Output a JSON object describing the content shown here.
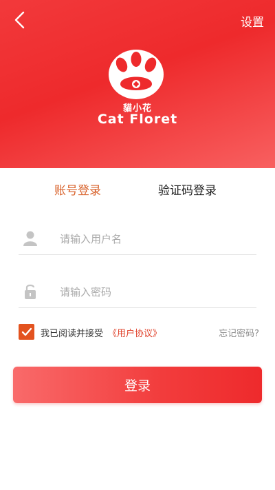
{
  "header": {
    "settings_label": "设置",
    "brand_cn": "貓小花",
    "brand_en": "Cat Floret"
  },
  "tabs": [
    {
      "label": "账号登录",
      "active": true
    },
    {
      "label": "验证码登录",
      "active": false
    }
  ],
  "form": {
    "username_placeholder": "请输入用户名",
    "password_placeholder": "请输入密码",
    "username_value": "",
    "password_value": ""
  },
  "agreement": {
    "checked": true,
    "text": "我已阅读并接受",
    "link": "《用户协议》",
    "forgot": "忘记密码?"
  },
  "login_button": "登录",
  "colors": {
    "header_red": "#ee2a2c",
    "active_tab": "#d8612a",
    "checkbox": "#e3531f",
    "link": "#e0412a"
  },
  "icons": {
    "back": "chevron-left-icon",
    "logo": "paw-icon",
    "user": "user-icon",
    "lock": "lock-icon",
    "check": "check-icon"
  }
}
